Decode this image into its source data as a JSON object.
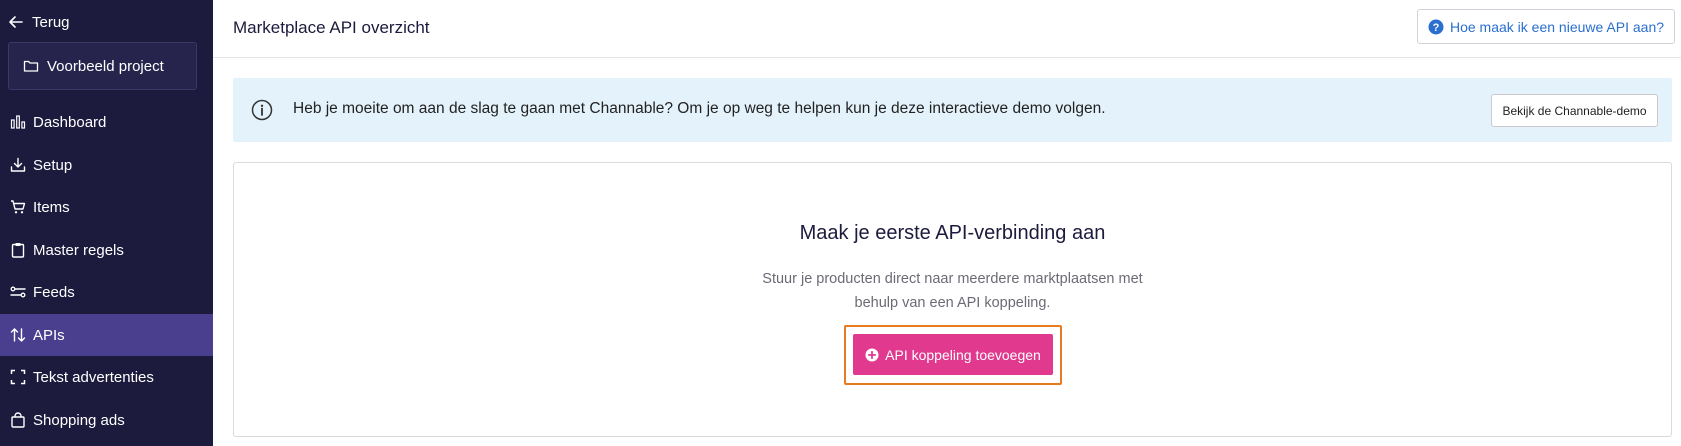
{
  "sidebar": {
    "back_label": "Terug",
    "project_name": "Voorbeeld project",
    "items": [
      {
        "label": "Dashboard",
        "icon": "bar-chart-icon"
      },
      {
        "label": "Setup",
        "icon": "download-tray-icon"
      },
      {
        "label": "Items",
        "icon": "cart-icon"
      },
      {
        "label": "Master regels",
        "icon": "clipboard-icon"
      },
      {
        "label": "Feeds",
        "icon": "feeds-icon"
      },
      {
        "label": "APIs",
        "icon": "swap-vertical-icon",
        "active": true
      },
      {
        "label": "Tekst advertenties",
        "icon": "expand-corners-icon"
      },
      {
        "label": "Shopping ads",
        "icon": "shopping-bag-icon"
      }
    ]
  },
  "header": {
    "title": "Marketplace API overzicht",
    "help_label": "Hoe maak ik een nieuwe API aan?"
  },
  "banner": {
    "text": "Heb je moeite om aan de slag te gaan met Channable? Om je op weg te helpen kun je deze interactieve demo volgen.",
    "demo_button_label": "Bekijk de Channable-demo"
  },
  "card": {
    "title": "Maak je eerste API-verbinding aan",
    "description_line1": "Stuur je producten direct naar meerdere marktplaatsen met",
    "description_line2": "behulp van een API koppeling.",
    "add_button_label": "API koppeling toevoegen"
  },
  "colors": {
    "sidebar_bg": "#1c1a3d",
    "sidebar_active": "#4a3f8f",
    "banner_bg": "#e4f3fb",
    "primary_button": "#e0398e",
    "highlight": "#e87b1f",
    "link": "#2a6fd0"
  }
}
